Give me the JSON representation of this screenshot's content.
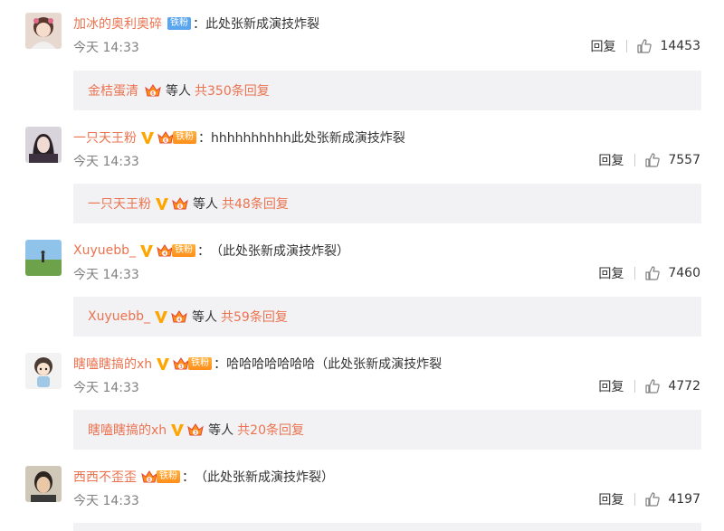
{
  "comments": [
    {
      "username": "加冰的奥利奥碎",
      "badge": "铁粉",
      "badge_style": "blue",
      "verified": false,
      "text": "此处张新成演技炸裂",
      "time": "今天 14:33",
      "reply_label": "回复",
      "likes": "14453",
      "sub_user": "金桔蛋清",
      "sub_deng": "等人",
      "sub_more": "共350条回复",
      "avatar_icon": "avatar-girl-icon"
    },
    {
      "username": "一只天王粉",
      "badge": "铁粉",
      "badge_style": "gold",
      "verified": true,
      "text": "hhhhhhhhhh此处张新成演技炸裂",
      "time": "今天 14:33",
      "reply_label": "回复",
      "likes": "7557",
      "sub_user": "一只天王粉",
      "sub_deng": "等人",
      "sub_more": "共48条回复",
      "avatar_icon": "avatar-portrait-icon"
    },
    {
      "username": "Xuyuebb_",
      "badge": "铁粉",
      "badge_style": "gold",
      "verified": true,
      "text": "（此处张新成演技炸裂）",
      "time": "今天 14:33",
      "reply_label": "回复",
      "likes": "7460",
      "sub_user": "Xuyuebb_",
      "sub_deng": "等人",
      "sub_more": "共59条回复",
      "avatar_icon": "avatar-field-icon"
    },
    {
      "username": "瞎嗑瞎搞的xh",
      "badge": "铁粉",
      "badge_style": "gold",
      "verified": true,
      "text": "哈哈哈哈哈哈哈（此处张新成演技炸裂",
      "time": "今天 14:33",
      "reply_label": "回复",
      "likes": "4772",
      "sub_user": "瞎嗑瞎搞的xh",
      "sub_deng": "等人",
      "sub_more": "共20条回复",
      "avatar_icon": "avatar-cartoon-icon"
    },
    {
      "username": "西西不歪歪",
      "badge": "铁粉",
      "badge_style": "gold",
      "verified": false,
      "text": "（此处张新成演技炸裂）",
      "time": "今天 14:33",
      "reply_label": "回复",
      "likes": "4197",
      "sub_user": "",
      "sub_deng": "",
      "sub_more": "",
      "avatar_icon": "avatar-boy-icon"
    }
  ],
  "colors": {
    "username": "#eb7350",
    "verified": "#ffa500",
    "badge_blue": "#5aa5f0",
    "badge_gold": "#ff8d1a",
    "subbox_bg": "#f2f2f5",
    "time": "#808080"
  }
}
